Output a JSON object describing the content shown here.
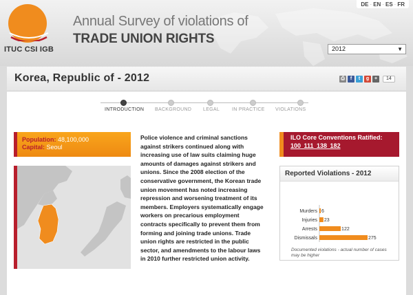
{
  "header": {
    "logo_text": "ITUC CSI IGB",
    "title_line1": "Annual Survey of violations of",
    "title_line2": "TRADE UNION RIGHTS",
    "languages": [
      "DE",
      "EN",
      "ES",
      "FR"
    ],
    "year_select": "2012"
  },
  "country": {
    "title": "Korea, Republic of - 2012",
    "share_count": "14"
  },
  "tabs": [
    {
      "label": "INTRODUCTION",
      "active": true
    },
    {
      "label": "BACKGROUND",
      "active": false
    },
    {
      "label": "LEGAL",
      "active": false
    },
    {
      "label": "IN PRACTICE",
      "active": false
    },
    {
      "label": "VIOLATIONS",
      "active": false
    }
  ],
  "facts": {
    "population_label": "Population:",
    "population_value": "48,100,000",
    "capital_label": "Capital:",
    "capital_value": "Seoul"
  },
  "narrative": "Police violence and criminal sanctions against strikers continued along with increasing use of law suits claiming huge amounts of damages against strikers and unions. Since the 2008 election of the conservative government, the Korean trade union movement has noted increasing repression and worsening treatment of its members. Employers systematically engage workers on precarious employment contracts specifically to prevent them from forming and joining trade unions. Trade union rights are restricted in the public sector, and amendments to the labour laws in 2010 further restricted union activity.",
  "ilo": {
    "title": "ILO Core Conventions Ratified:",
    "conventions": "100 111 138 182"
  },
  "violations": {
    "title": "Reported Violations - 2012",
    "note": "Documented violations - actual number of cases may be higher"
  },
  "chart_data": {
    "type": "bar",
    "orientation": "horizontal",
    "categories": [
      "Murders",
      "Injuries",
      "Arrests",
      "Dismissals"
    ],
    "values": [
      6,
      23,
      122,
      275
    ],
    "bar_color": "#f08c1e"
  }
}
